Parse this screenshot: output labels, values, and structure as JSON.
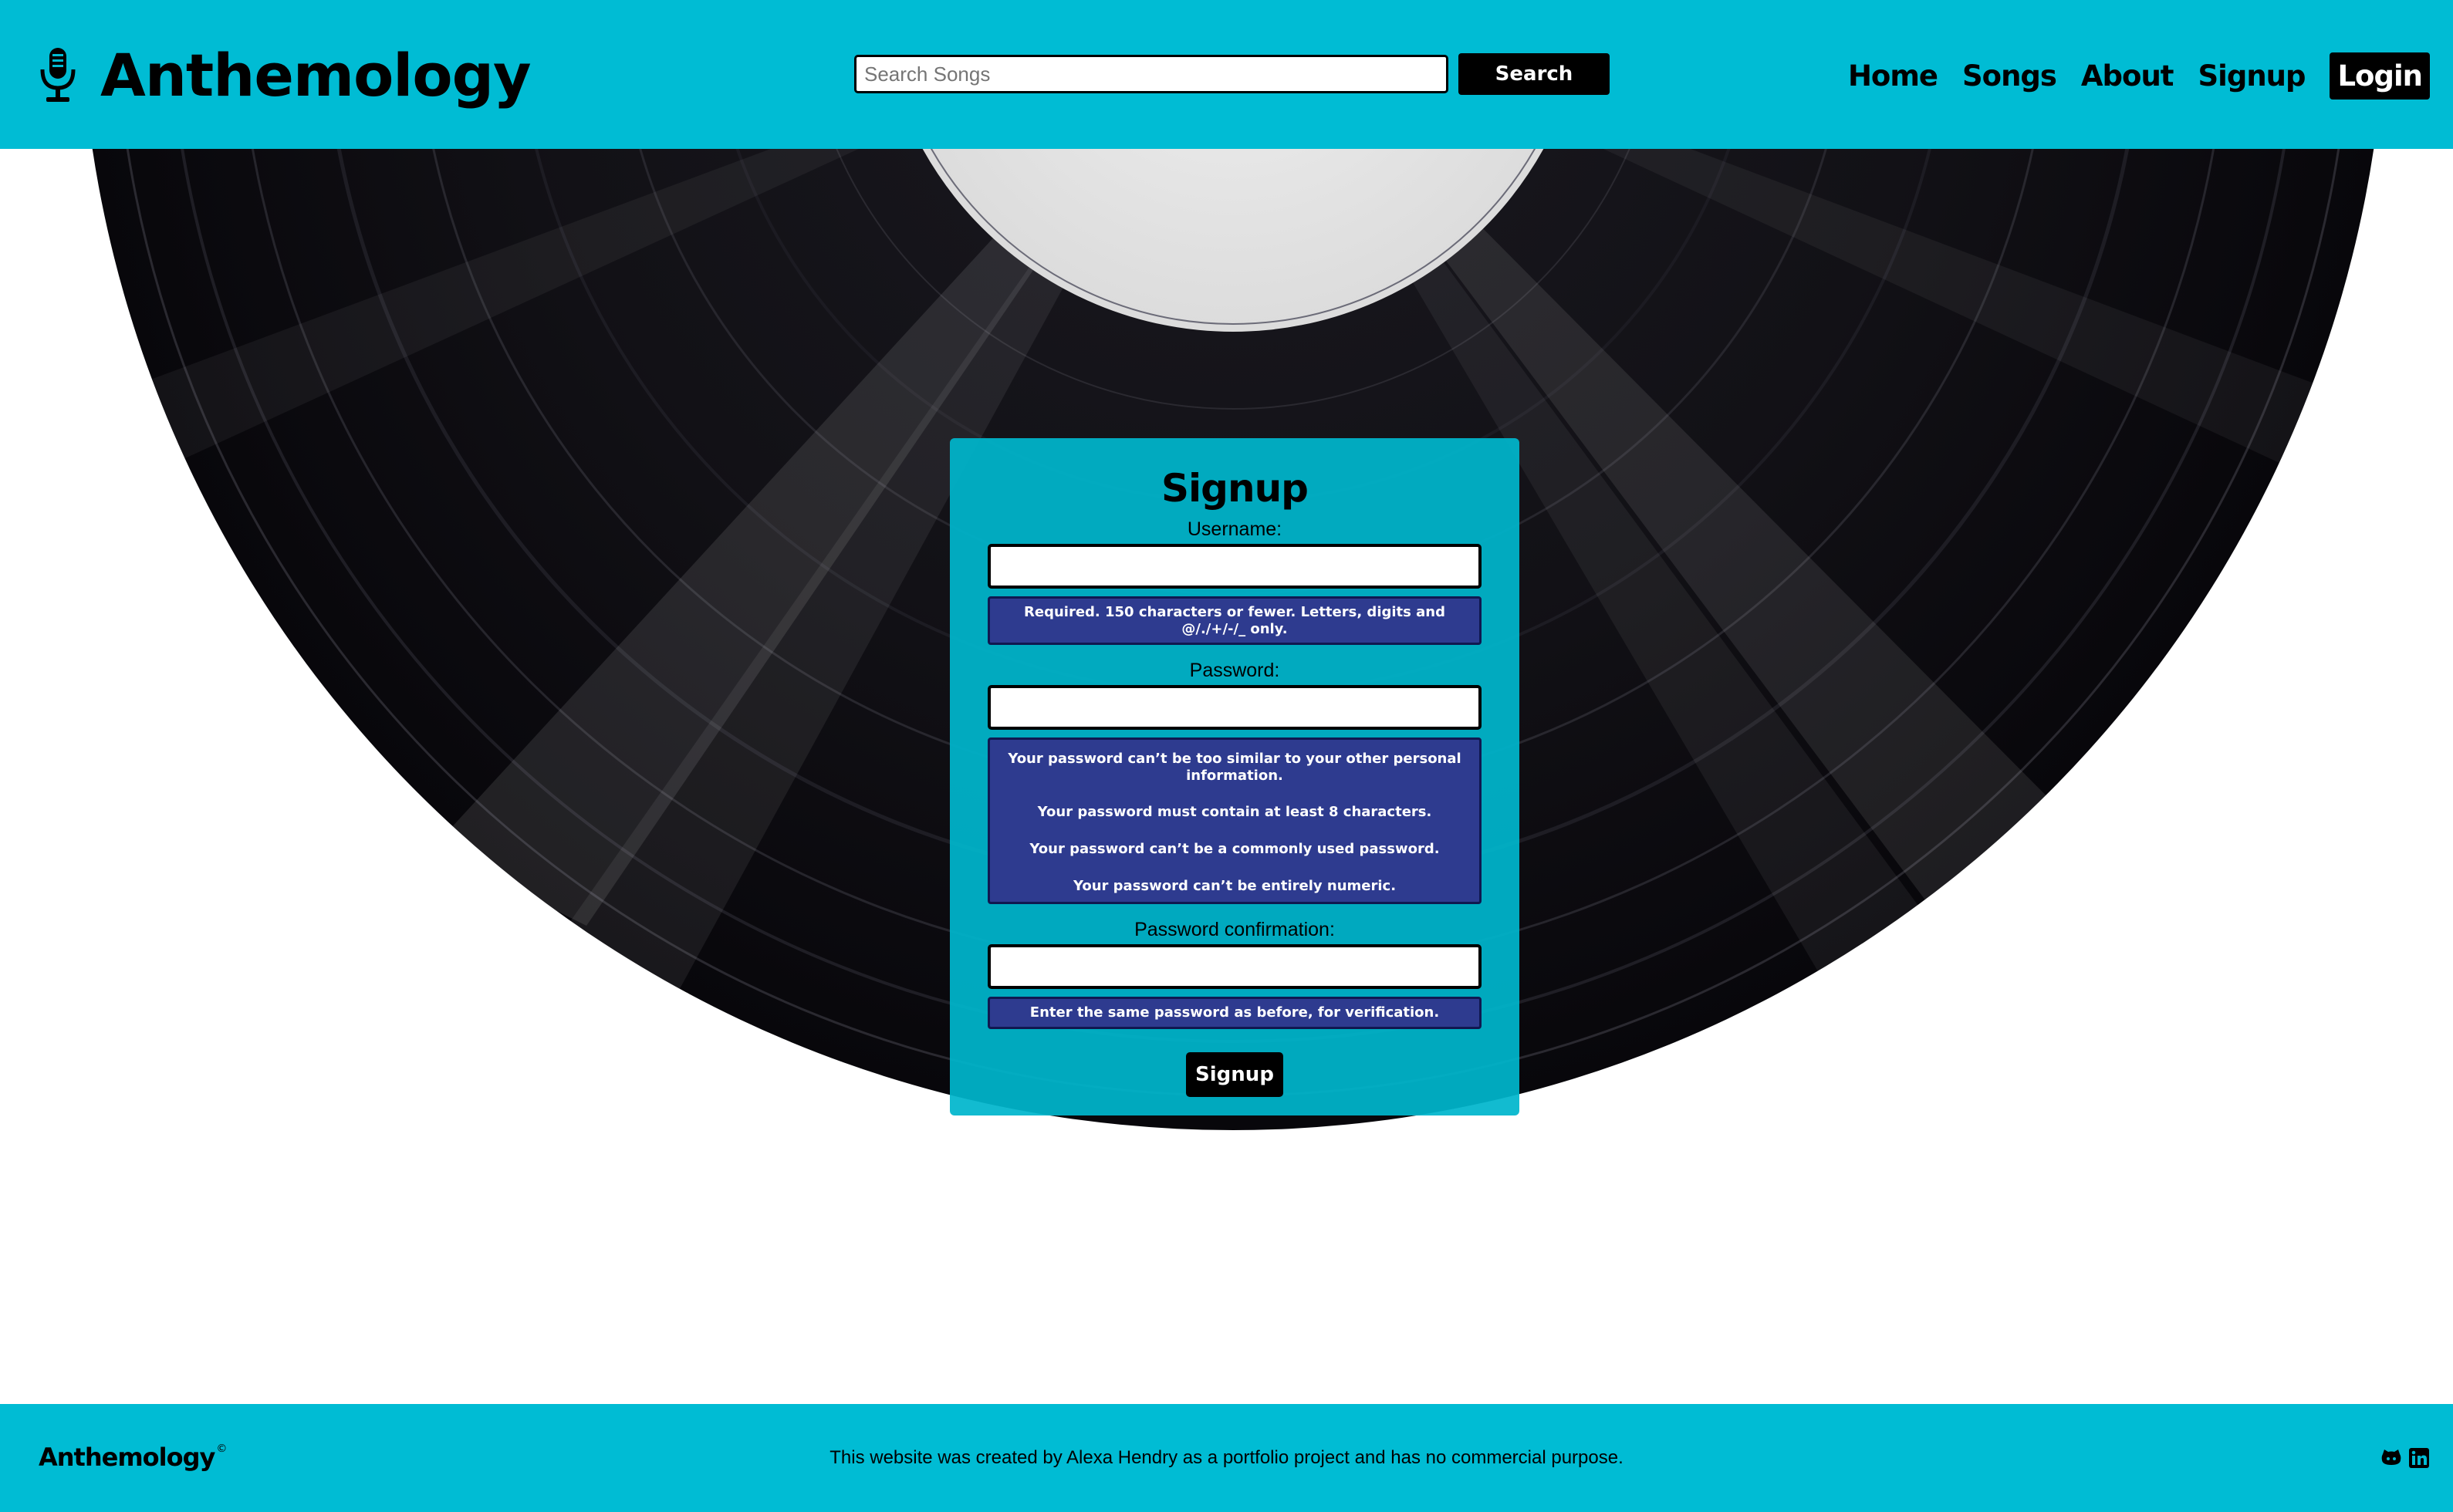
{
  "header": {
    "brand_name": "Anthemology",
    "brand_icon": "microphone-icon",
    "search": {
      "placeholder": "Search Songs",
      "value": "",
      "button_label": "Search"
    },
    "nav": [
      {
        "label": "Home",
        "active": false
      },
      {
        "label": "Songs",
        "active": false
      },
      {
        "label": "About",
        "active": false
      },
      {
        "label": "Signup",
        "active": false
      },
      {
        "label": "Login",
        "active": true
      }
    ]
  },
  "signup_form": {
    "title": "Signup",
    "username": {
      "label": "Username:",
      "value": "",
      "help": "Required. 150 characters or fewer. Letters, digits and @/./+/-/_ only."
    },
    "password": {
      "label": "Password:",
      "value": "",
      "help": [
        "Your password can’t be too similar to your other personal information.",
        "Your password must contain at least 8 characters.",
        "Your password can’t be a commonly used password.",
        "Your password can’t be entirely numeric."
      ]
    },
    "password_confirmation": {
      "label": "Password confirmation:",
      "value": "",
      "help": "Enter the same password as before, for verification."
    },
    "submit_label": "Signup"
  },
  "footer": {
    "brand_name": "Anthemology",
    "copyright_symbol": "©",
    "text": "This website was created by Alexa Hendry as a portfolio project and has no commercial purpose.",
    "social_icons": [
      "github-icon",
      "linkedin-icon"
    ]
  },
  "colors": {
    "primary": "#00bcd4",
    "help_box": "#2e3b8f",
    "button": "#000000",
    "vinyl": "#0e0d12",
    "label_disc": "#e7e7e7"
  }
}
